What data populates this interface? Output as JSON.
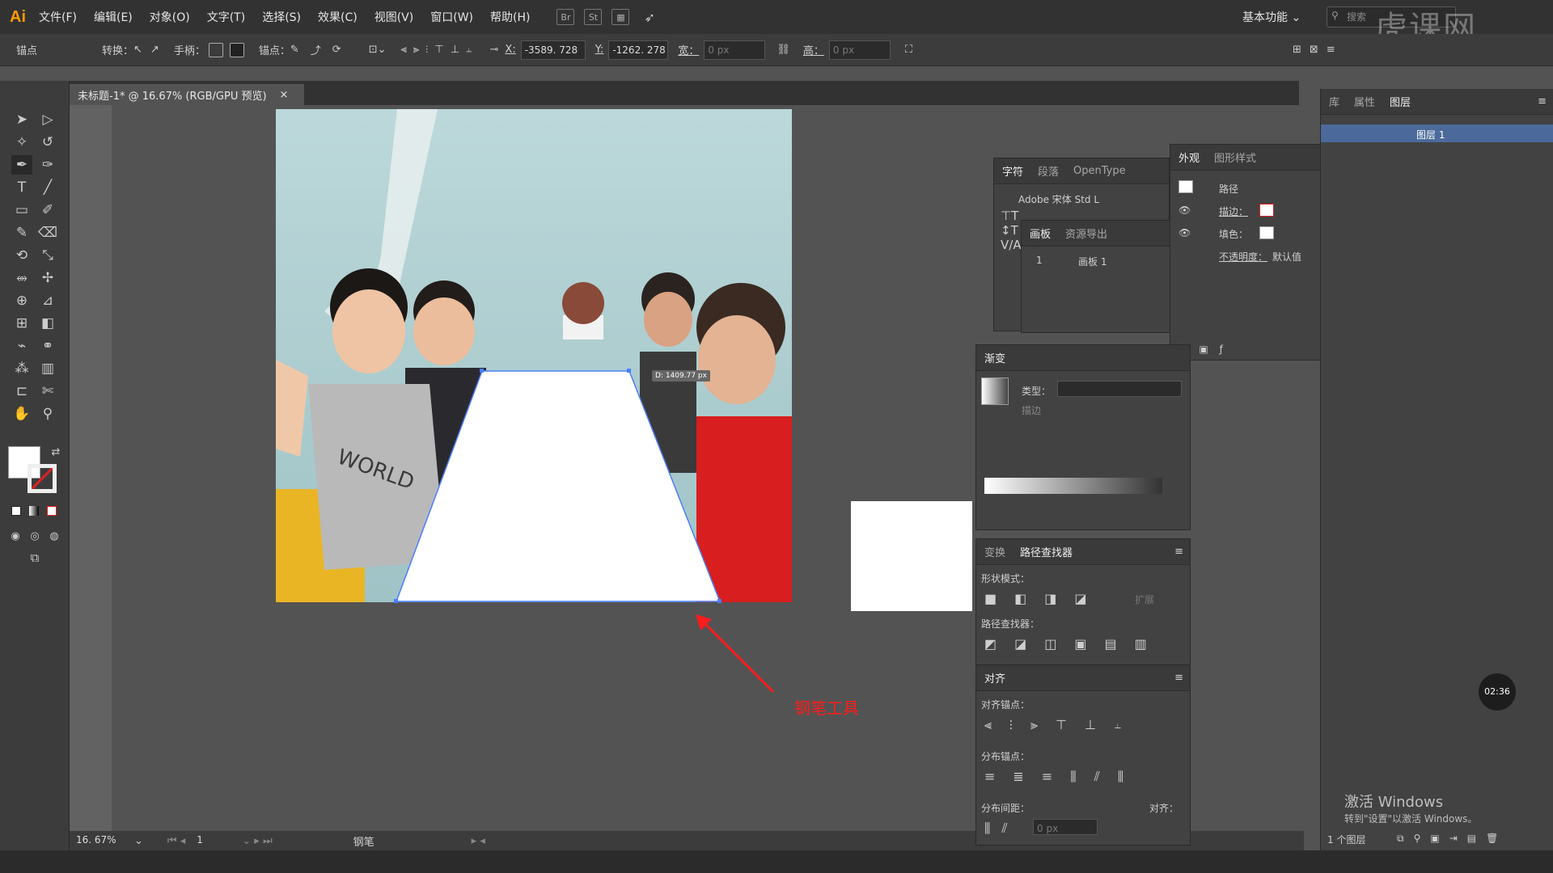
{
  "app": {
    "logo": "Ai"
  },
  "menu": [
    "文件(F)",
    "编辑(E)",
    "对象(O)",
    "文字(T)",
    "选择(S)",
    "效果(C)",
    "视图(V)",
    "窗口(W)",
    "帮助(H)"
  ],
  "menu_icons": [
    "Br",
    "St"
  ],
  "workspace": "基本功能 ⌄",
  "search_placeholder": "搜索",
  "watermark": "虎课网",
  "control": {
    "anchor": "锚点",
    "convert": "转换：",
    "handle": "手柄：",
    "anchor_pt": "锚点：",
    "x_label": "X:",
    "x_value": "-3589. 728",
    "y_label": "Y:",
    "y_value": "-1262. 278",
    "w_label": "宽：",
    "w_value": "0 px",
    "h_label": "高：",
    "h_value": "0 px"
  },
  "doc_tab": {
    "title": "未标题-1* @ 16.67% (RGB/GPU 预览)",
    "close": "×"
  },
  "selection_readout": "D: 1409.77 px",
  "annotation": "钢笔工具",
  "status": {
    "zoom": "16. 67%",
    "page": "1",
    "tool": "钢笔"
  },
  "right_col": {
    "tabs": [
      "库",
      "属性",
      "图层"
    ],
    "layer": "图层 1",
    "footer": "1 个图层"
  },
  "appearance": {
    "tabs": [
      "外观",
      "图形样式"
    ],
    "path": "路径",
    "stroke": "描边：",
    "fill": "填色：",
    "opacity": "不透明度：",
    "opacity_val": "默认值"
  },
  "char": {
    "tabs": [
      "字符",
      "段落",
      "OpenType"
    ],
    "font": "Adobe 宋体 Std L"
  },
  "artboard": {
    "tabs": [
      "画板",
      "资源导出"
    ],
    "num": "1",
    "name": "画板 1"
  },
  "gradient": {
    "title": "渐变",
    "type": "类型：",
    "stroke": "描边"
  },
  "pathfinder": {
    "tabs": [
      "变换",
      "路径查找器"
    ],
    "shape_modes": "形状模式：",
    "pathfinders": "路径查找器：",
    "expand": "扩展"
  },
  "align": {
    "title": "对齐",
    "align_anchor": "对齐锚点：",
    "dist_anchor": "分布锚点：",
    "dist_space": "分布间距：",
    "align_to": "对齐：",
    "space_val": "0 px"
  },
  "timer": "02:36",
  "activate": {
    "line1": "激活 Windows",
    "line2": "转到\"设置\"以激活 Windows。"
  },
  "colors": {
    "accent": "#ff9a00",
    "annotation": "#ff1c1c",
    "selection": "#4a7fff"
  }
}
